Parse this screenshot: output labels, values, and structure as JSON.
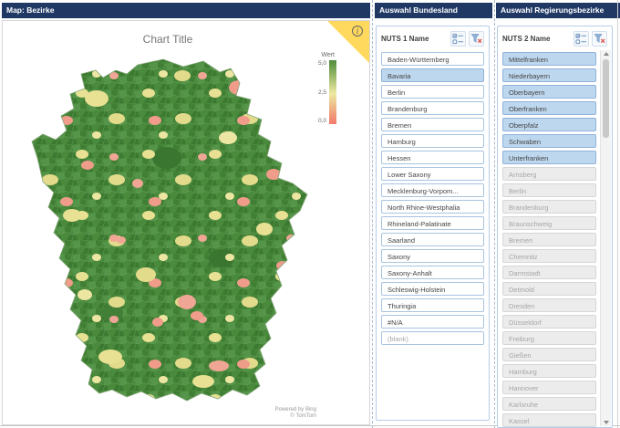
{
  "colors": {
    "header_bg": "#1F3864",
    "slicer_selected": "#BDD7EE",
    "info_yellow": "#FFD95E",
    "map_green": "#4A8A3C",
    "map_yellow": "#E8E193",
    "map_salmon": "#F09C8A",
    "legend_top": "#4E8C3B",
    "legend_mid": "#ECE9A0",
    "legend_bottom": "#F2796B"
  },
  "panels": {
    "map": {
      "header": "Map: Bezirke",
      "chart_title": "Chart Title",
      "legend": {
        "title": "Wert",
        "max": "5,0",
        "mid": "2,5",
        "min": "0,0"
      },
      "info_icon_label": "i",
      "attribution": [
        "Powered by Bing",
        "© TomTom"
      ]
    },
    "bundesland": {
      "header": "Auswahl Bundesland",
      "slicer_title": "NUTS 1 Name",
      "items": [
        {
          "label": "Baden-Württemberg"
        },
        {
          "label": "Bavaria",
          "state": "selected"
        },
        {
          "label": "Berlin"
        },
        {
          "label": "Brandenburg"
        },
        {
          "label": "Bremen"
        },
        {
          "label": "Hamburg"
        },
        {
          "label": "Hessen"
        },
        {
          "label": "Lower Saxony"
        },
        {
          "label": "Mecklenburg-Vorpom..."
        },
        {
          "label": "North Rhine-Westphalia"
        },
        {
          "label": "Rhineland-Palatinate"
        },
        {
          "label": "Saarland"
        },
        {
          "label": "Saxony"
        },
        {
          "label": "Saxony-Anhalt"
        },
        {
          "label": "Schleswig-Holstein"
        },
        {
          "label": "Thuringia"
        },
        {
          "label": "#N/A"
        },
        {
          "label": "(blank)",
          "state": "blank"
        }
      ]
    },
    "regierungsbezirke": {
      "header": "Auswahl Regierungsbezirke",
      "slicer_title": "NUTS 2 Name",
      "items": [
        {
          "label": "Mittelfranken",
          "state": "selected"
        },
        {
          "label": "Niederbayern",
          "state": "selected"
        },
        {
          "label": "Oberbayern",
          "state": "selected"
        },
        {
          "label": "Oberfranken",
          "state": "selected"
        },
        {
          "label": "Oberpfalz",
          "state": "selected"
        },
        {
          "label": "Schwaben",
          "state": "selected"
        },
        {
          "label": "Unterfranken",
          "state": "selected"
        },
        {
          "label": "Arnsberg",
          "state": "disabled"
        },
        {
          "label": "Berlin",
          "state": "disabled"
        },
        {
          "label": "Brandenburg",
          "state": "disabled"
        },
        {
          "label": "Braunschweig",
          "state": "disabled"
        },
        {
          "label": "Bremen",
          "state": "disabled"
        },
        {
          "label": "Chemnitz",
          "state": "disabled"
        },
        {
          "label": "Darmstadt",
          "state": "disabled"
        },
        {
          "label": "Detmold",
          "state": "disabled"
        },
        {
          "label": "Dresden",
          "state": "disabled"
        },
        {
          "label": "Düsseldorf",
          "state": "disabled"
        },
        {
          "label": "Freiburg",
          "state": "disabled"
        },
        {
          "label": "Gießen",
          "state": "disabled"
        },
        {
          "label": "Hamburg",
          "state": "disabled"
        },
        {
          "label": "Hannover",
          "state": "disabled"
        },
        {
          "label": "Karlsruhe",
          "state": "disabled"
        },
        {
          "label": "Kassel",
          "state": "disabled"
        }
      ]
    }
  }
}
